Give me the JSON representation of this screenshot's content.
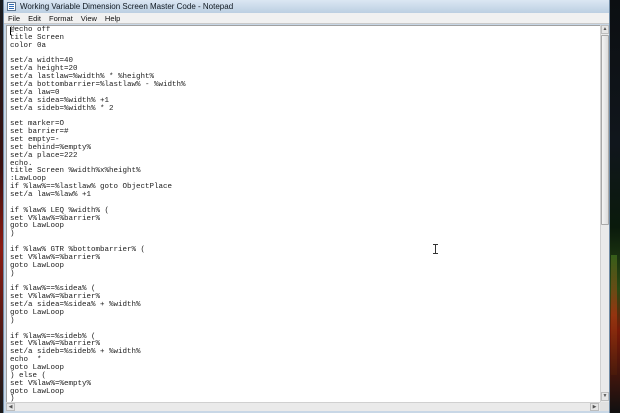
{
  "window": {
    "title": "Working Variable Dimension Screen Master Code - Notepad",
    "app_icon": "notepad-icon"
  },
  "menu": [
    "File",
    "Edit",
    "Format",
    "View",
    "Help"
  ],
  "editor": {
    "lines": [
      "@echo off",
      "title Screen",
      "color 0a",
      "",
      "set/a width=40",
      "set/a height=20",
      "set/a lastlaw=%width% * %height%",
      "set/a bottombarrier=%lastlaw% - %width%",
      "set/a law=0",
      "set/a sidea=%width% +1",
      "set/a sideb=%width% * 2",
      "",
      "set marker=O",
      "set barrier=#",
      "set empty=-",
      "set behind=%empty%",
      "set/a place=222",
      "echo.",
      "title Screen %width%x%height%",
      ":LawLoop",
      "if %law%==%lastlaw% goto ObjectPlace",
      "set/a law=%law% +1",
      "",
      "if %law% LEQ %width% (",
      "set V%law%=%barrier%",
      "goto LawLoop",
      ")",
      "",
      "if %law% GTR %bottombarrier% (",
      "set V%law%=%barrier%",
      "goto LawLoop",
      ")",
      "",
      "if %law%==%sidea% (",
      "set V%law%=%barrier%",
      "set/a sidea=%sidea% + %width%",
      "goto LawLoop",
      ")",
      "",
      "if %law%==%sideb% (",
      "set V%law%=%barrier%",
      "set/a sideb=%sideb% + %width%",
      "echo  *",
      "goto LawLoop",
      ") else (",
      "set V%law%=%empty%",
      "goto LawLoop",
      ")"
    ]
  },
  "scrollbar": {
    "up_icon": "scroll-up-arrow-icon",
    "down_icon": "scroll-down-arrow-icon",
    "left_icon": "scroll-left-arrow-icon",
    "right_icon": "scroll-right-arrow-icon"
  }
}
